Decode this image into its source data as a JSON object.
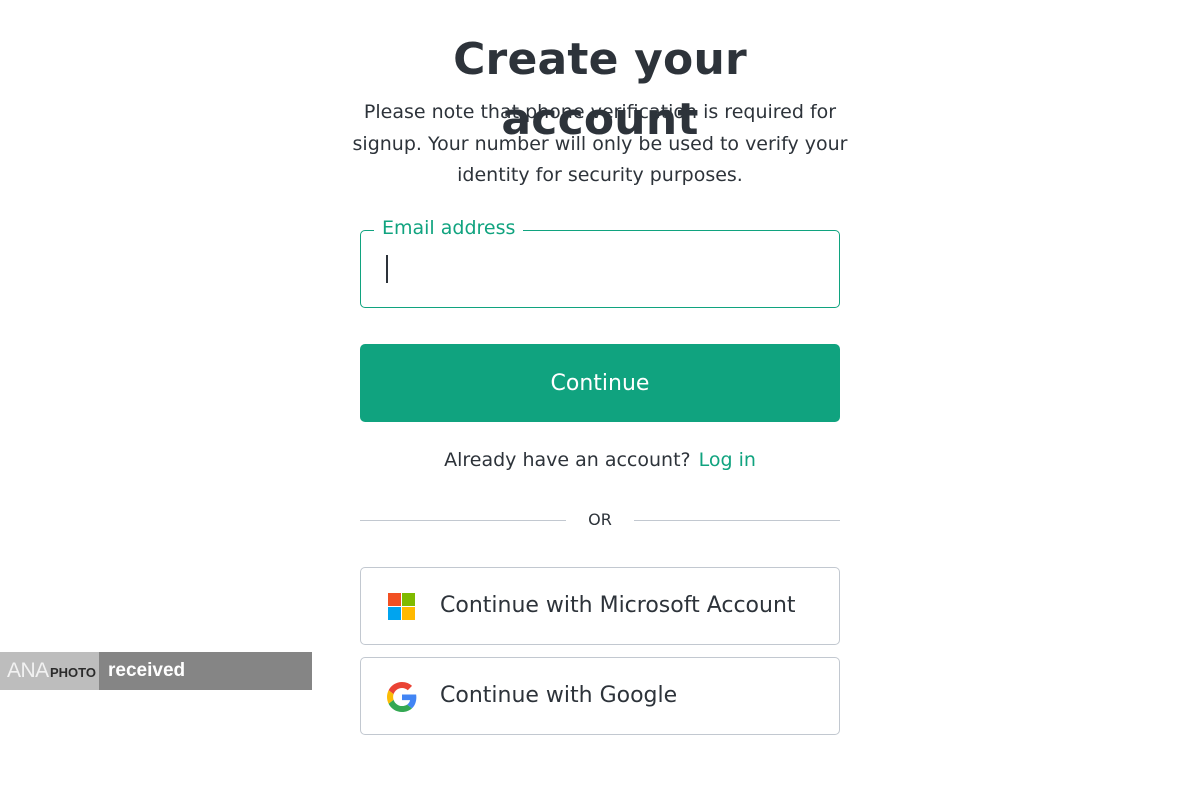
{
  "header": {
    "title": "Create your account",
    "subtitle": "Please note that phone verification is required for signup. Your number will only be used to verify your identity for security purposes."
  },
  "form": {
    "email_label": "Email address",
    "email_value": "",
    "continue_label": "Continue"
  },
  "login_prompt": {
    "text": "Already have an account?",
    "link_label": "Log in"
  },
  "divider": {
    "text": "OR"
  },
  "social": {
    "microsoft": {
      "label": "Continue with Microsoft Account",
      "icon": "microsoft-logo-icon"
    },
    "google": {
      "label": "Continue with Google",
      "icon": "google-logo-icon"
    }
  },
  "watermark": {
    "brand": "ANA",
    "brand_suffix": "PHOTO",
    "status": "received"
  },
  "colors": {
    "accent": "#10a37f",
    "text": "#2d333a",
    "border": "#c2c8d0"
  }
}
